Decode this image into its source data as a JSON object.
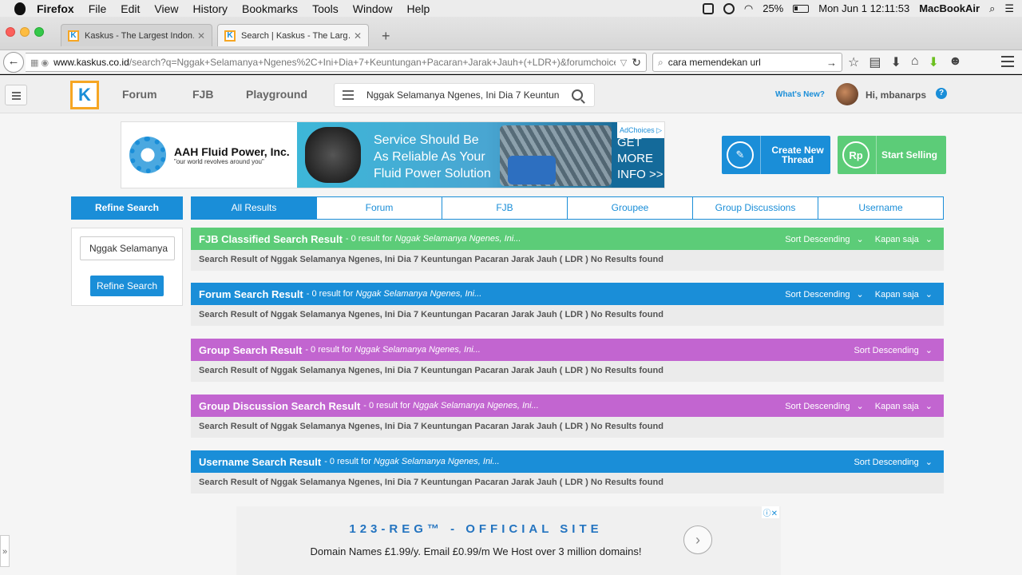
{
  "menubar": {
    "items": [
      "Firefox",
      "File",
      "Edit",
      "View",
      "History",
      "Bookmarks",
      "Tools",
      "Window",
      "Help"
    ],
    "battery": "25%",
    "clock": "Mon Jun 1  12:11:53",
    "computer": "MacBookAir"
  },
  "browser": {
    "tabs": [
      {
        "title": "Kaskus - The Largest Indon…"
      },
      {
        "title": "Search | Kaskus - The Larg…"
      }
    ],
    "new_tab": "+",
    "url_host": "www.kaskus.co.id",
    "url_rest": "/search?q=Nggak+Selamanya+Ngenes%2C+Ini+Dia+7+Keuntungan+Pacaran+Jarak+Jauh+(+LDR+)&forumchoice=",
    "search_value": "cara memendekan url"
  },
  "header": {
    "nav": [
      "Forum",
      "FJB",
      "Playground"
    ],
    "search_value": "Nggak Selamanya Ngenes, Ini Dia 7 Keuntun",
    "whats_new": "What's New?",
    "greeting": "Hi, mbanarps",
    "help": "?"
  },
  "ad_top": {
    "company": "AAH Fluid Power, Inc.",
    "tagline": "\"our world revolves around you\"",
    "slogan_l1": "Service Should Be",
    "slogan_l2": "As Reliable As Your",
    "slogan_l3": "Fluid Power Solution",
    "cta_l1": "GET",
    "cta_l2": "MORE",
    "cta_l3": "INFO >>",
    "adchoices": "AdChoices ▷"
  },
  "actions": {
    "create_l1": "Create New",
    "create_l2": "Thread",
    "sell": "Start Selling",
    "sell_icon": "Rp"
  },
  "refine": {
    "header": "Refine Search",
    "input_value": "Nggak Selamanya",
    "button": "Refine Search"
  },
  "result_tabs": [
    "All Results",
    "Forum",
    "FJB",
    "Groupee",
    "Group Discussions",
    "Username"
  ],
  "results": [
    {
      "title": "FJB Classified Search Result",
      "count": " - 0 result for ",
      "query": "Nggak Selamanya Ngenes, Ini...",
      "sort": "Sort Descending",
      "time": "Kapan saja",
      "body": "Search Result of Nggak Selamanya Ngenes, Ini Dia 7 Keuntungan Pacaran Jarak Jauh ( LDR ) No Results found"
    },
    {
      "title": "Forum Search Result",
      "count": " - 0 result for ",
      "query": "Nggak Selamanya Ngenes, Ini...",
      "sort": "Sort Descending",
      "time": "Kapan saja",
      "body": "Search Result of Nggak Selamanya Ngenes, Ini Dia 7 Keuntungan Pacaran Jarak Jauh ( LDR ) No Results found"
    },
    {
      "title": "Group Search Result",
      "count": " - 0 result for ",
      "query": "Nggak Selamanya Ngenes, Ini...",
      "sort": "Sort Descending",
      "time": "",
      "body": "Search Result of Nggak Selamanya Ngenes, Ini Dia 7 Keuntungan Pacaran Jarak Jauh ( LDR ) No Results found"
    },
    {
      "title": "Group Discussion Search Result",
      "count": " - 0 result for ",
      "query": "Nggak Selamanya Ngenes, Ini...",
      "sort": "Sort Descending",
      "time": "Kapan saja",
      "body": "Search Result of Nggak Selamanya Ngenes, Ini Dia 7 Keuntungan Pacaran Jarak Jauh ( LDR ) No Results found"
    },
    {
      "title": "Username Search Result",
      "count": " - 0 result for ",
      "query": "Nggak Selamanya Ngenes, Ini...",
      "sort": "Sort Descending",
      "time": "",
      "body": "Search Result of Nggak Selamanya Ngenes, Ini Dia 7 Keuntungan Pacaran Jarak Jauh ( LDR ) No Results found"
    }
  ],
  "ad_bottom": {
    "headline": "123-REG™ - OFFICIAL SITE",
    "text": "Domain Names £1.99/y. Email £0.99/m We Host over 3 million domains!",
    "close": "ⓘ✕",
    "arrow": "›"
  },
  "colors": {
    "kaskus_blue": "#1a8ed8",
    "fjb_green": "#5ccc78",
    "group_purple": "#c265d0",
    "logo_orange": "#f6a623"
  }
}
